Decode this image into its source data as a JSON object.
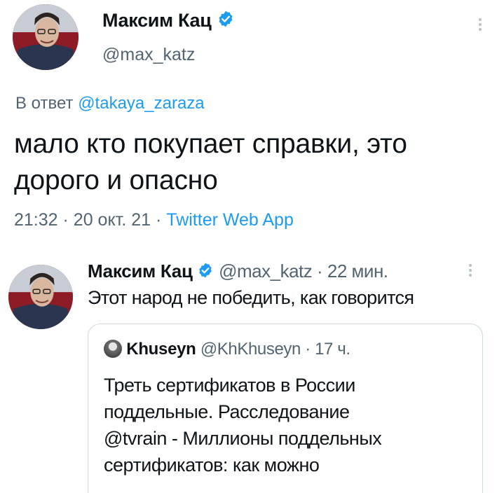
{
  "main_tweet": {
    "author_name": "Максим Кац",
    "handle": "@max_katz",
    "reply_prefix": "В ответ",
    "reply_to": "@takaya_zaraza",
    "text_line1": "мало кто покупает справки, это",
    "text_line2": "дорого и опасно",
    "time": "21:32",
    "date": "20 окт. 21",
    "separator": "·",
    "source": "Twitter Web App"
  },
  "reply_tweet": {
    "author_name": "Максим Кац",
    "handle": "@max_katz",
    "separator": "·",
    "age": "22 мин.",
    "text": "Этот народ не победить, как говорится"
  },
  "quoted_tweet": {
    "author_name": "Khuseyn",
    "handle": "@KhKhuseyn",
    "separator": "·",
    "age": "17 ч.",
    "lines": [
      "Треть сертификатов в России",
      "поддельные. Расследование",
      "@tvrain - Миллионы поддельных",
      "сертификатов: как можно"
    ]
  },
  "icons": {
    "verified": "verified-badge-icon",
    "more": "more-options-icon"
  },
  "colors": {
    "link_blue": "#1d9bf0",
    "muted_gray": "#536471",
    "text": "#0f1419"
  }
}
